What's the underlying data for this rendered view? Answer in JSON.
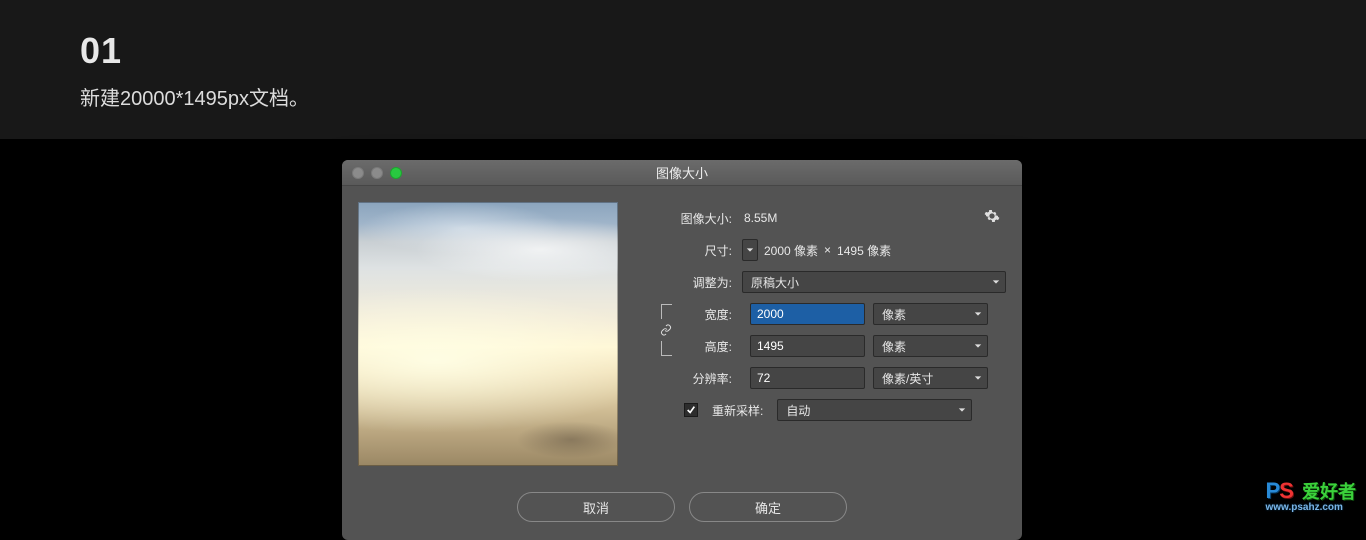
{
  "header": {
    "step_number": "01",
    "description": "新建20000*1495px文档。"
  },
  "dialog": {
    "title": "图像大小",
    "size_label": "图像大小:",
    "size_value": "8.55M",
    "dim_label": "尺寸:",
    "dim_width": "2000 像素",
    "dim_sep": "×",
    "dim_height": "1495 像素",
    "fit_label": "调整为:",
    "fit_value": "原稿大小",
    "width_label": "宽度:",
    "width_value": "2000",
    "width_unit": "像素",
    "height_label": "高度:",
    "height_value": "1495",
    "height_unit": "像素",
    "res_label": "分辨率:",
    "res_value": "72",
    "res_unit": "像素/英寸",
    "resample_label": "重新采样:",
    "resample_value": "自动",
    "cancel": "取消",
    "ok": "确定"
  },
  "watermark": {
    "p": "P",
    "s": "S",
    "cn": "爱好者",
    "url": "www.psahz.com"
  }
}
